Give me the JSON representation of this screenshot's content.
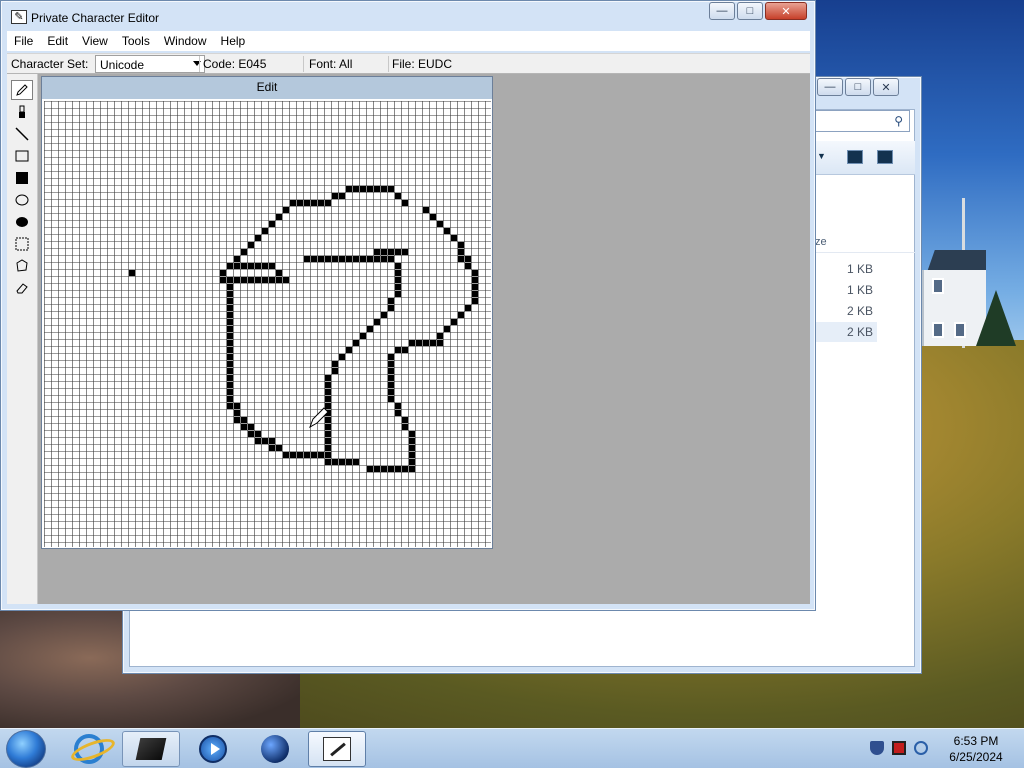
{
  "pce": {
    "title": "Private Character Editor",
    "menu": [
      "File",
      "Edit",
      "View",
      "Tools",
      "Window",
      "Help"
    ],
    "info": {
      "charset_label": "Character Set:",
      "charset_value": "Unicode",
      "code": "Code: E045",
      "font": "Font: All",
      "file": "File: EUDC"
    },
    "edit_caption": "Edit",
    "tools": [
      "pencil",
      "brush",
      "line",
      "hollow-rectangle",
      "filled-rectangle",
      "hollow-ellipse",
      "filled-ellipse",
      "rectangular-selection",
      "freeform-selection",
      "eraser"
    ],
    "active_tool": "pencil",
    "grid_size": 64,
    "glyph_rows": [
      "................................................................",
      "................................................................",
      "................................................................",
      "................................................................",
      "................................................................",
      "................................................................",
      "................................................................",
      "................................................................",
      "................................................................",
      "................................................................",
      "................................................................",
      "................................................................",
      "...........................................#######..............",
      ".........................................##.......#.............",
      "...................................######..........#..........",
      "..................................#...................#.........",
      ".................................#.....................#........",
      "................................#.......................#.......",
      "...............................#.........................#......",
      "..............................#...........................#.....",
      ".............................#.............................#....",
      "............................#..................#####.......#....",
      "...........................#.........#############.........##..",
      "..........................#######.................#.........#..",
      ".........................#.......#................#..........#.",
      ".........................##########...............#..........#.",
      "..........................#.......................#..........#.",
      "..........................#.......................#..........#.",
      "..........................#......................#...........#.",
      "..........................#......................#..........#..",
      "..........................#.....................#..........#...",
      "..........................#....................#..........#....",
      "..........................#...................#..........#.....",
      "..........................#..................#..........#......",
      "..........................#.................#.......#####......",
      "..........................#................#......##...........",
      "..........................#...............#......#.............",
      "..........................#..............#.......#.............",
      "..........................#..............#.......#.............",
      "..........................#.............#........#.............",
      "..........................#.............#........#.............",
      "..........................#.............#........#.............",
      "..........................#.............#........#.............",
      "..........................##............#.........#............",
      "...........................#............#.........#............",
      "...........................##...........#..........#...........",
      "............................##..........#..........#...........",
      ".............................##.........#...........#..........",
      "..............................###.......#...........#..........",
      "................................##......#...........#..........",
      "..................................#######...........#..........",
      "........................................#####.......#..........",
      "..............................................#######..........",
      "................................................................",
      "................................................................",
      "................................................................",
      "................................................................",
      "................................................................",
      "................................................................",
      "................................................................",
      "................................................................",
      "................................................................",
      "................................................................",
      "................................................................"
    ],
    "stray_pixels": [
      [
        12,
        24
      ]
    ]
  },
  "explorer": {
    "column_header": "ze",
    "sizes": [
      "1 KB",
      "1 KB",
      "2 KB",
      "2 KB"
    ]
  },
  "taskbar": {
    "apps": [
      "internet-explorer",
      "tb-app-cube",
      "windows-media-player",
      "tb-app-globe",
      "private-character-editor"
    ],
    "time": "6:53 PM",
    "date": "6/25/2024"
  },
  "colors": {
    "grid_line": "#3a3a3a",
    "pixel_on": "#000000",
    "edit_caption_bg": "#b4c8dc",
    "client_bg": "#ababab"
  }
}
